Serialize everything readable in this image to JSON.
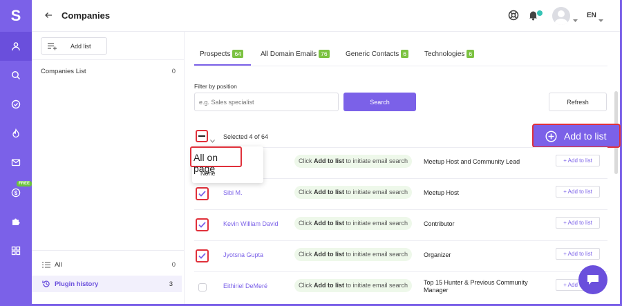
{
  "brand": {
    "logo_letter": "S",
    "accent": "#7b61e8",
    "highlight": "#e0303a",
    "badge_green": "#7cc242"
  },
  "header": {
    "title": "Companies",
    "language": "EN"
  },
  "rail": {
    "items": [
      {
        "name": "contacts-icon",
        "active": true
      },
      {
        "name": "search-icon"
      },
      {
        "name": "check-circle-icon"
      },
      {
        "name": "fire-icon"
      },
      {
        "name": "mail-icon"
      },
      {
        "name": "dollar-icon",
        "badge": "FREE"
      },
      {
        "name": "puzzle-icon"
      },
      {
        "name": "apps-grid-icon"
      }
    ]
  },
  "sidebar": {
    "add_list_label": "Add list",
    "lists": [
      {
        "label": "Companies List",
        "count": "0"
      }
    ],
    "all": {
      "label": "All",
      "count": "0"
    },
    "plugin_history": {
      "label": "Plugin history",
      "count": "3"
    }
  },
  "tabs": [
    {
      "label": "Prospects",
      "count": "64",
      "active": true
    },
    {
      "label": "All Domain Emails",
      "count": "76"
    },
    {
      "label": "Generic Contacts",
      "count": "6"
    },
    {
      "label": "Technologies",
      "count": "6"
    }
  ],
  "filter": {
    "label": "Filter by position",
    "placeholder": "e.g. Sales specialist",
    "search_label": "Search",
    "refresh_label": "Refresh"
  },
  "selection": {
    "text": "Selected 4 of 64",
    "add_to_list_label": "Add to list",
    "menu": [
      "All on page",
      "None"
    ]
  },
  "rows": [
    {
      "name": "",
      "hint_prefix": "Click ",
      "hint_bold": "Add to list",
      "hint_suffix": " to initiate email search",
      "role": "Meetup Host and Community Lead",
      "action": "+ Add to list",
      "checked": true
    },
    {
      "name": "Sibi M.",
      "hint_prefix": "Click ",
      "hint_bold": "Add to list",
      "hint_suffix": " to initiate email search",
      "role": "Meetup Host",
      "action": "+ Add to list",
      "checked": true
    },
    {
      "name": "Kevin William David",
      "hint_prefix": "Click ",
      "hint_bold": "Add to list",
      "hint_suffix": " to initiate email search",
      "role": "Contributor",
      "action": "+ Add to list",
      "checked": true
    },
    {
      "name": "Jyotsna Gupta",
      "hint_prefix": "Click ",
      "hint_bold": "Add to list",
      "hint_suffix": " to initiate email search",
      "role": "Organizer",
      "action": "+ Add to list",
      "checked": true
    },
    {
      "name": "Eithiriel DeMeré",
      "hint_prefix": "Click ",
      "hint_bold": "Add to list",
      "hint_suffix": " to initiate email search",
      "role": "Top 15 Hunter & Previous Community Manager",
      "action": "+ Add to list",
      "checked": false
    }
  ]
}
